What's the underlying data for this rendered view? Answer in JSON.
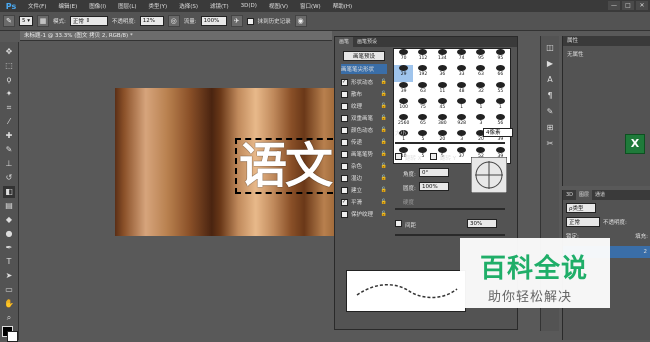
{
  "app": {
    "logo": "Ps",
    "menu": [
      "文件(F)",
      "编辑(E)",
      "图像(I)",
      "图层(L)",
      "类型(Y)",
      "选择(S)",
      "滤镜(T)",
      "3D(D)",
      "视图(V)",
      "窗口(W)",
      "帮助(H)"
    ],
    "window_controls": [
      "—",
      "□",
      "✕"
    ]
  },
  "options_bar": {
    "brush_size": "5",
    "mode_label": "模式:",
    "mode_value": "正常",
    "opacity_label": "不透明度:",
    "opacity_value": "12%",
    "flow_label": "流量:",
    "flow_value": "100%",
    "history_label": "抹到历史记录"
  },
  "document": {
    "tab_title": "未标题-1 @ 33.3% (图文 拷贝 2, RGB/8) *",
    "canvas_text": "语文"
  },
  "brush_panel": {
    "tabs": [
      "画笔",
      "画笔预设"
    ],
    "preset_button": "画笔预设",
    "tip_shape_button": "画笔笔尖形状",
    "options": [
      {
        "label": "形状动态",
        "checked": true
      },
      {
        "label": "散布",
        "checked": false
      },
      {
        "label": "纹理",
        "checked": false
      },
      {
        "label": "双重画笔",
        "checked": false
      },
      {
        "label": "颜色动态",
        "checked": false
      },
      {
        "label": "传递",
        "checked": false
      },
      {
        "label": "画笔笔势",
        "checked": false
      },
      {
        "label": "杂色",
        "checked": false
      },
      {
        "label": "湿边",
        "checked": false
      },
      {
        "label": "建立",
        "checked": false
      },
      {
        "label": "平滑",
        "checked": true
      },
      {
        "label": "保护纹理",
        "checked": false
      }
    ],
    "grid_numbers": [
      "70",
      "112",
      "134",
      "74",
      "95",
      "95",
      "29",
      "192",
      "36",
      "33",
      "63",
      "66",
      "39",
      "63",
      "11",
      "48",
      "32",
      "55",
      "100",
      "75",
      "45",
      "1",
      "1",
      "1",
      "2560",
      "65",
      "380",
      "928",
      "3",
      "56",
      "1",
      "5",
      "20",
      "3",
      "20",
      "39",
      "10",
      "5",
      "5",
      "37",
      "52",
      "39"
    ],
    "size_label": "大小",
    "size_value": "4像素",
    "flip_x": "翻转 X",
    "flip_y": "翻转 Y",
    "angle_label": "角度:",
    "angle_value": "0°",
    "roundness_label": "圆度:",
    "roundness_value": "100%",
    "hardness_label": "硬度",
    "spacing_label": "间距",
    "spacing_value": "30%"
  },
  "properties_panel": {
    "title": "属性",
    "content": "无属性"
  },
  "layers_panel": {
    "tabs": [
      "3D",
      "图层",
      "通道"
    ],
    "kind_label": "ρ类型",
    "blend_mode": "正常",
    "opacity_label": "不透明度:",
    "fill_label": "填充:",
    "lock_label": "锁定:",
    "layer_name_suffix": "2"
  },
  "watermark": {
    "title": "百科全说",
    "subtitle": "助你轻松解决"
  }
}
